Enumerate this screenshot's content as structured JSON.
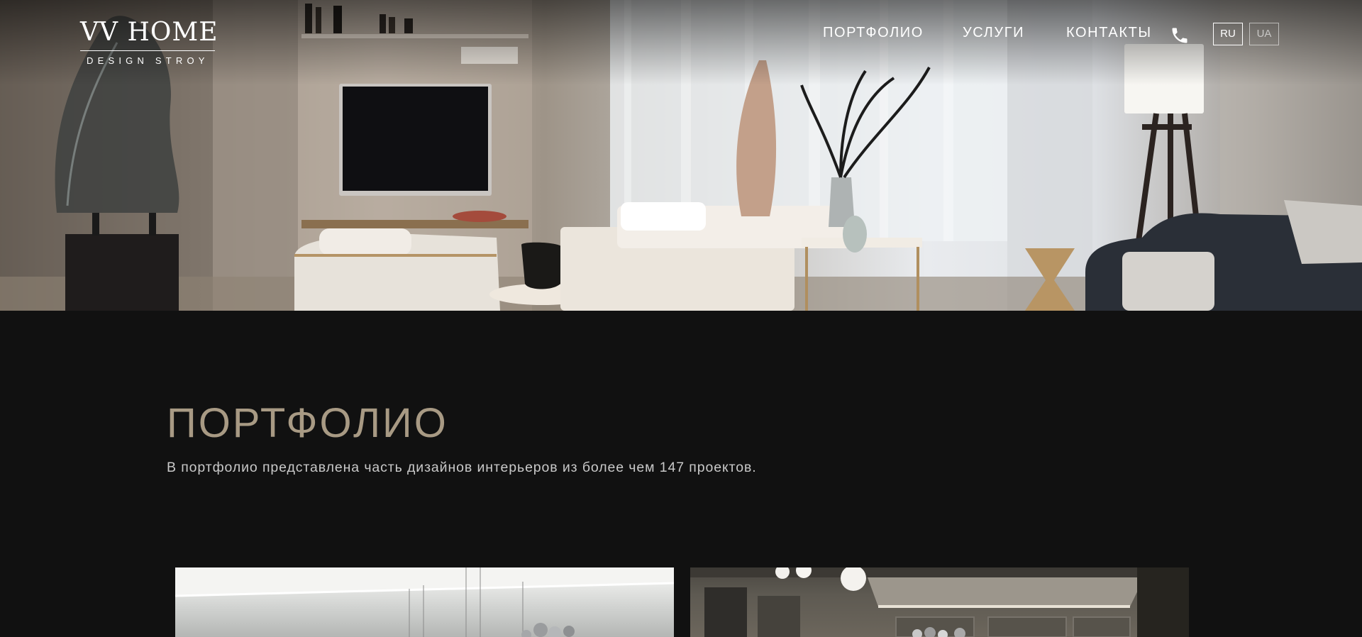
{
  "header": {
    "logo": {
      "title": "VV HOME",
      "subtitle": "DESIGN STROY"
    },
    "nav": [
      {
        "label": "ПОРТФОЛИО"
      },
      {
        "label": "УСЛУГИ"
      },
      {
        "label": "КОНТАКТЫ"
      }
    ],
    "phone_icon": "phone-icon",
    "languages": [
      {
        "code": "RU",
        "active": true
      },
      {
        "code": "UA",
        "active": false
      }
    ]
  },
  "hero": {
    "image": "luxury living room interior with TV, sofas, floor lamp and sculpture"
  },
  "portfolio": {
    "title": "ПОРТФОЛИО",
    "description": "В портфолио представлена часть дизайнов интерьеров из более чем 147 проектов."
  },
  "projects": [
    {
      "image": "bright dining room with glass bubble chandelier"
    },
    {
      "image": "dark dining room with globe chandelier and molding walls"
    }
  ],
  "colors": {
    "background": "#111111",
    "accent": "#a89a84",
    "text": "#c9c9c9"
  }
}
